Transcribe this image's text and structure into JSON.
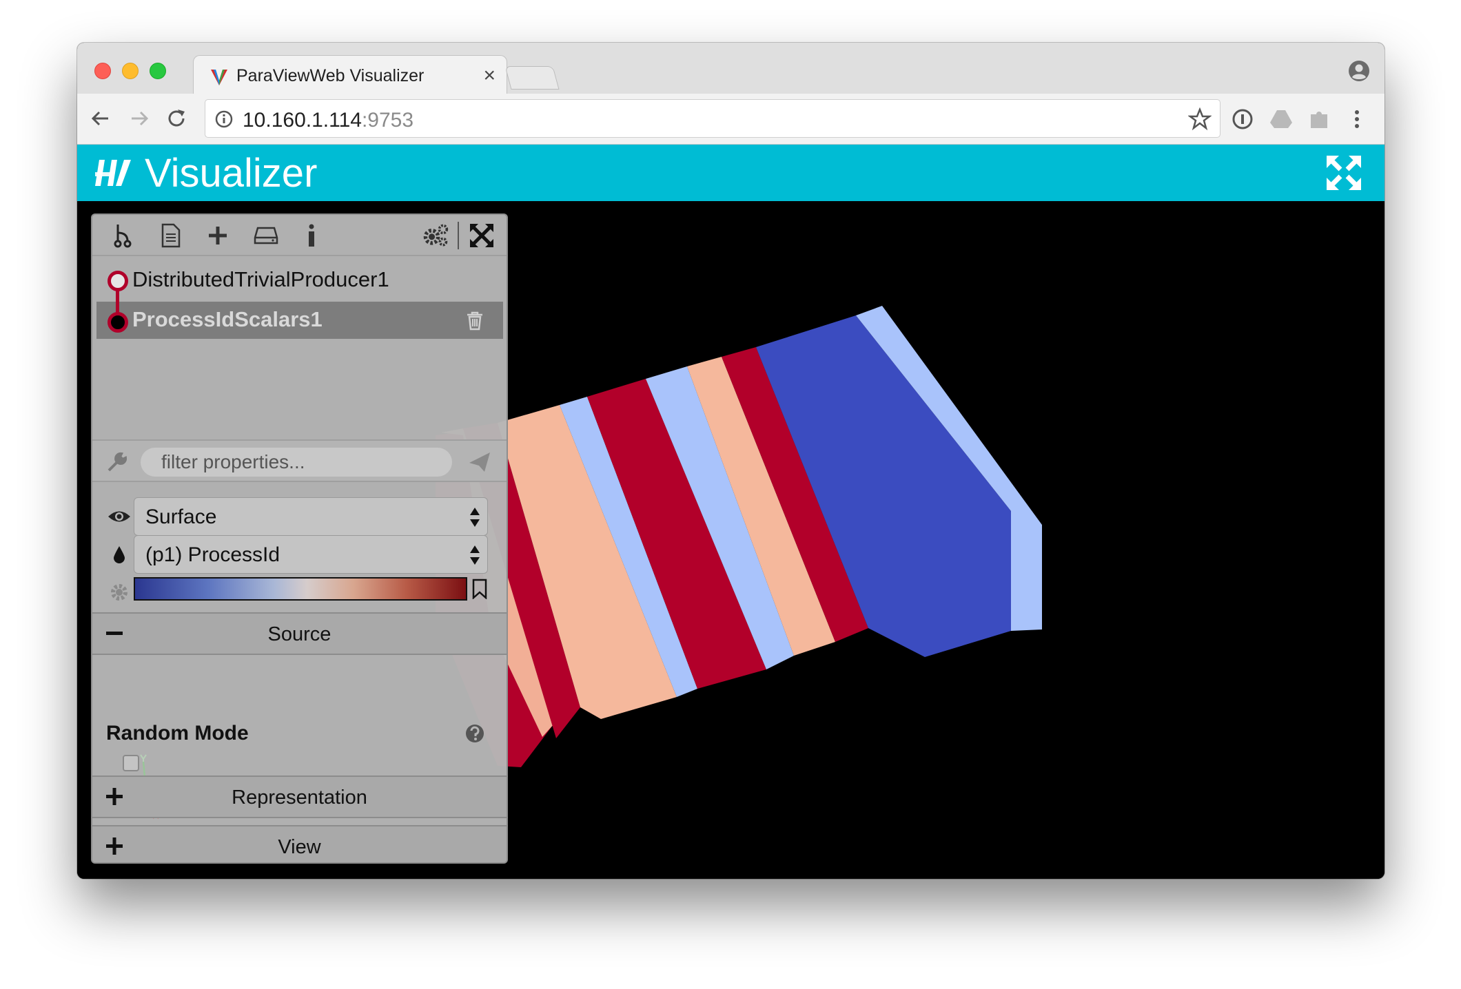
{
  "browser": {
    "tab_title": "ParaViewWeb Visualizer",
    "tab_close": "×",
    "url_host": "10.160.1.114",
    "url_port": ":9753"
  },
  "app": {
    "title": "Visualizer",
    "header_color": "#00bcd4"
  },
  "pipeline": {
    "items": [
      {
        "label": "DistributedTrivialProducer1",
        "selected": false
      },
      {
        "label": "ProcessIdScalars1",
        "selected": true
      }
    ]
  },
  "filter": {
    "placeholder": "filter properties..."
  },
  "properties": {
    "representation_value": "Surface",
    "color_by_value": "(p1) ProcessId",
    "colormap_colors": [
      "#2b3790",
      "#d6cccb",
      "#7b0f12"
    ]
  },
  "sections": {
    "source": {
      "label": "Source",
      "toggle": "−"
    },
    "representation": {
      "label": "Representation",
      "toggle": "+"
    },
    "view": {
      "label": "View",
      "toggle": "+"
    }
  },
  "source_props": {
    "random_mode_label": "Random Mode",
    "random_mode_checked": false
  },
  "render_colors": {
    "dark_red": "#b2002a",
    "light_salmon": "#f5b89c",
    "light_blue": "#a9c3fb",
    "dark_blue": "#3b4cc0"
  }
}
